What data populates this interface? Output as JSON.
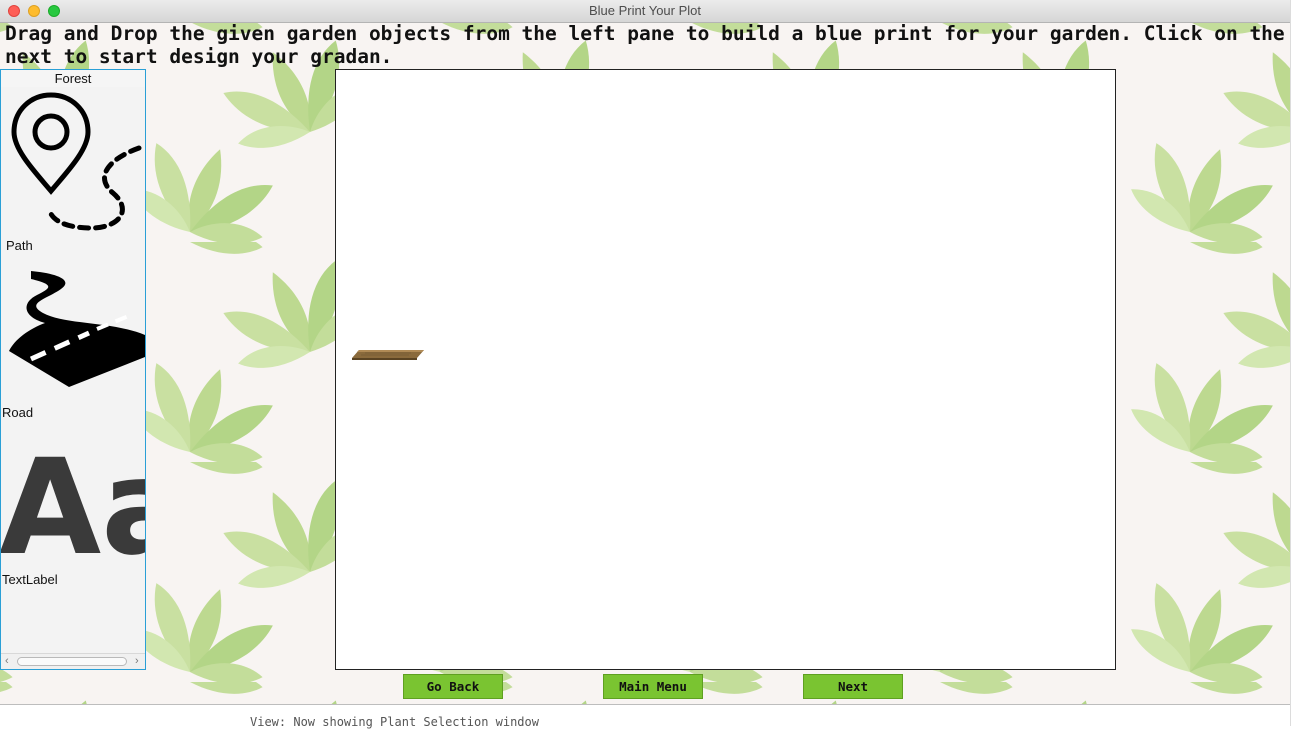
{
  "window": {
    "title": "Blue Print Your Plot"
  },
  "instructions": "Drag and Drop the given garden objects from the left pane to build a blue print for your garden. Click on the next to start design your gradan.",
  "palette": {
    "header": "Forest",
    "items": [
      {
        "label": "Path",
        "icon": "map-pin-dotted-path-icon"
      },
      {
        "label": "Road",
        "icon": "curved-road-icon"
      },
      {
        "label": "TextLabel",
        "icon": "text-aa-icon"
      }
    ],
    "icon_glyph": "Aa"
  },
  "canvas": {
    "placed_items": [
      "wooden-plank"
    ]
  },
  "buttons": {
    "back": "Go Back",
    "menu": "Main Menu",
    "next": "Next"
  },
  "console_line": "View: Now showing Plant Selection window",
  "colors": {
    "button_green": "#7ac431",
    "palette_border": "#2a9fd6",
    "leaf_green": "#a6cf6e"
  }
}
